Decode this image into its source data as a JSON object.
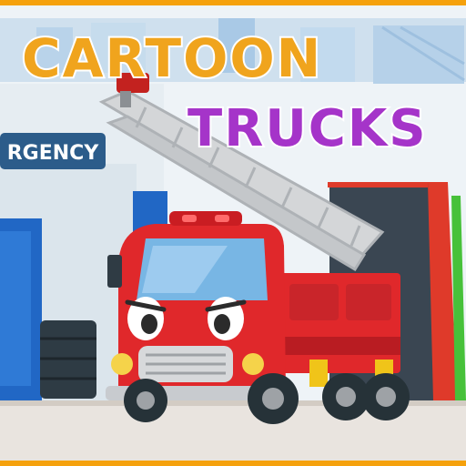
{
  "title": {
    "line1": "CARTOON",
    "line2": "TRUCKS"
  },
  "sign": {
    "text": "RGENCY"
  },
  "colors": {
    "sky": "#eef3f7",
    "frame": "#f5a10c",
    "ground": "#e9e4df",
    "building": "#dde7ee",
    "sign_bg": "#2c5c8a",
    "sign_text": "#ffffff",
    "truck_red": "#e0282b",
    "truck_dark_red": "#b91c22",
    "ladder": "#d4d6d8",
    "window_blue": "#78b6e4",
    "door_blue": "#2167c5",
    "garage_red": "#df3a2a",
    "garage_green": "#47c13a",
    "title_orange": "#f0a41d",
    "title_green": "#4ac03d",
    "title_purple": "#a534c9"
  },
  "icons": {
    "siren": "siren-icon",
    "headlight": "headlight-icon"
  }
}
